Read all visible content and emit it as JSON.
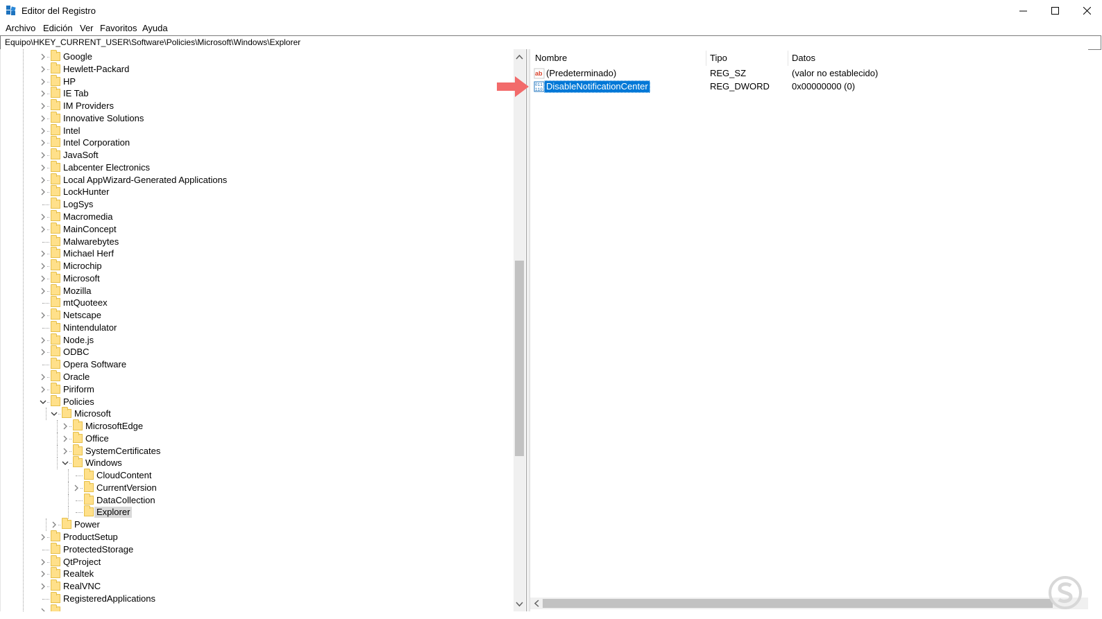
{
  "window": {
    "title": "Editor del Registro"
  },
  "menu": [
    "Archivo",
    "Edición",
    "Ver",
    "Favoritos",
    "Ayuda"
  ],
  "address": "Equipo\\HKEY_CURRENT_USER\\Software\\Policies\\Microsoft\\Windows\\Explorer",
  "tree": [
    {
      "label": "Google",
      "depth": 0,
      "expander": "collapsed"
    },
    {
      "label": "Hewlett-Packard",
      "depth": 0,
      "expander": "collapsed"
    },
    {
      "label": "HP",
      "depth": 0,
      "expander": "collapsed"
    },
    {
      "label": "IE Tab",
      "depth": 0,
      "expander": "collapsed"
    },
    {
      "label": "IM Providers",
      "depth": 0,
      "expander": "collapsed"
    },
    {
      "label": "Innovative Solutions",
      "depth": 0,
      "expander": "collapsed"
    },
    {
      "label": "Intel",
      "depth": 0,
      "expander": "collapsed"
    },
    {
      "label": "Intel Corporation",
      "depth": 0,
      "expander": "collapsed"
    },
    {
      "label": "JavaSoft",
      "depth": 0,
      "expander": "collapsed"
    },
    {
      "label": "Labcenter Electronics",
      "depth": 0,
      "expander": "collapsed"
    },
    {
      "label": "Local AppWizard-Generated Applications",
      "depth": 0,
      "expander": "collapsed"
    },
    {
      "label": "LockHunter",
      "depth": 0,
      "expander": "collapsed"
    },
    {
      "label": "LogSys",
      "depth": 0,
      "expander": "none"
    },
    {
      "label": "Macromedia",
      "depth": 0,
      "expander": "collapsed"
    },
    {
      "label": "MainConcept",
      "depth": 0,
      "expander": "collapsed"
    },
    {
      "label": "Malwarebytes",
      "depth": 0,
      "expander": "none"
    },
    {
      "label": "Michael Herf",
      "depth": 0,
      "expander": "collapsed"
    },
    {
      "label": "Microchip",
      "depth": 0,
      "expander": "collapsed"
    },
    {
      "label": "Microsoft",
      "depth": 0,
      "expander": "collapsed"
    },
    {
      "label": "Mozilla",
      "depth": 0,
      "expander": "collapsed"
    },
    {
      "label": "mtQuoteex",
      "depth": 0,
      "expander": "none"
    },
    {
      "label": "Netscape",
      "depth": 0,
      "expander": "collapsed"
    },
    {
      "label": "Nintendulator",
      "depth": 0,
      "expander": "none"
    },
    {
      "label": "Node.js",
      "depth": 0,
      "expander": "collapsed"
    },
    {
      "label": "ODBC",
      "depth": 0,
      "expander": "collapsed"
    },
    {
      "label": "Opera Software",
      "depth": 0,
      "expander": "none"
    },
    {
      "label": "Oracle",
      "depth": 0,
      "expander": "collapsed"
    },
    {
      "label": "Piriform",
      "depth": 0,
      "expander": "collapsed"
    },
    {
      "label": "Policies",
      "depth": 0,
      "expander": "expanded"
    },
    {
      "label": "Microsoft",
      "depth": 1,
      "expander": "expanded"
    },
    {
      "label": "MicrosoftEdge",
      "depth": 2,
      "expander": "collapsed"
    },
    {
      "label": "Office",
      "depth": 2,
      "expander": "collapsed"
    },
    {
      "label": "SystemCertificates",
      "depth": 2,
      "expander": "collapsed"
    },
    {
      "label": "Windows",
      "depth": 2,
      "expander": "expanded"
    },
    {
      "label": "CloudContent",
      "depth": 3,
      "expander": "none"
    },
    {
      "label": "CurrentVersion",
      "depth": 3,
      "expander": "collapsed"
    },
    {
      "label": "DataCollection",
      "depth": 3,
      "expander": "none"
    },
    {
      "label": "Explorer",
      "depth": 3,
      "expander": "none",
      "selected": true
    },
    {
      "label": "Power",
      "depth": 1,
      "expander": "collapsed"
    },
    {
      "label": "ProductSetup",
      "depth": 0,
      "expander": "collapsed"
    },
    {
      "label": "ProtectedStorage",
      "depth": 0,
      "expander": "none"
    },
    {
      "label": "QtProject",
      "depth": 0,
      "expander": "collapsed"
    },
    {
      "label": "Realtek",
      "depth": 0,
      "expander": "collapsed"
    },
    {
      "label": "RealVNC",
      "depth": 0,
      "expander": "collapsed"
    },
    {
      "label": "RegisteredApplications",
      "depth": 0,
      "expander": "none"
    },
    {
      "label": "",
      "depth": 0,
      "expander": "collapsed"
    }
  ],
  "values": {
    "columns": {
      "name": "Nombre",
      "type": "Tipo",
      "data": "Datos"
    },
    "rows": [
      {
        "name": "(Predeterminado)",
        "type": "REG_SZ",
        "data": "(valor no establecido)",
        "icon": "string-value-icon",
        "selected": false
      },
      {
        "name": "DisableNotificationCenter",
        "type": "REG_DWORD",
        "data": "0x00000000 (0)",
        "icon": "binary-value-icon",
        "selected": true
      }
    ]
  },
  "colors": {
    "selection": "#0078d7",
    "folder": "#ffe08a",
    "annotation_arrow": "#f26b6b",
    "tree_selection": "#d9d9d9"
  }
}
